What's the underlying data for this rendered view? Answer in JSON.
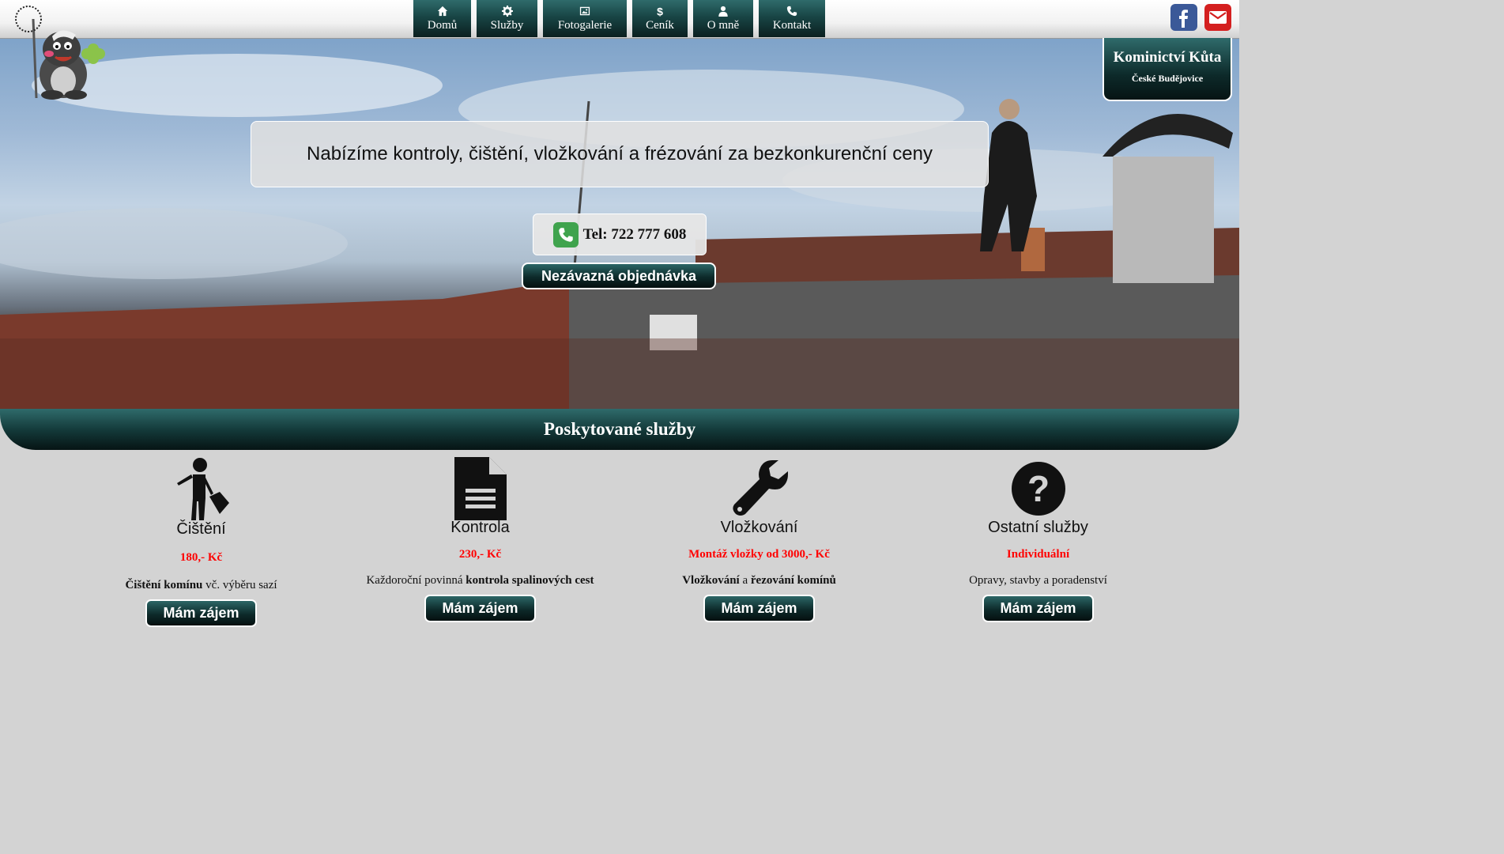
{
  "nav": [
    {
      "label": "Domů",
      "icon": "home-icon"
    },
    {
      "label": "Služby",
      "icon": "gear-icon"
    },
    {
      "label": "Fotogalerie",
      "icon": "image-icon"
    },
    {
      "label": "Ceník",
      "icon": "dollar-icon"
    },
    {
      "label": "O mně",
      "icon": "user-icon"
    },
    {
      "label": "Kontakt",
      "icon": "phone-icon"
    }
  ],
  "social": [
    {
      "icon": "facebook-icon",
      "color": "#3b5998"
    },
    {
      "icon": "mail-icon",
      "color": "#d41f1f"
    }
  ],
  "brand": {
    "title": "Kominictví Kůta",
    "subtitle": "České Budějovice"
  },
  "hero": {
    "headline": "Nabízíme kontroly, čištění, vložkování a frézování za bezkonkurenční ceny",
    "phone": "Tel: 722 777 608",
    "order_button": "Nezávazná objednávka"
  },
  "services_heading": "Poskytované služby",
  "services": [
    {
      "title": "Čištění",
      "price": "180,- Kč",
      "desc_bold": "Čištění komínu",
      "desc_rest": " vč. výběru sazí",
      "button": "Mám zájem",
      "icon": "chimney-sweep-icon"
    },
    {
      "title": "Kontrola",
      "price": "230,- Kč",
      "desc_pre": "Každoroční povinná ",
      "desc_bold": "kontrola spalinových cest",
      "button": "Mám zájem",
      "icon": "document-icon"
    },
    {
      "title": "Vložkování",
      "price": "Montáž vložky od 3000,- Kč",
      "desc_bold": "Vložkování",
      "desc_mid": " a ",
      "desc_bold2": "řezování komínů",
      "button": "Mám zájem",
      "icon": "wrench-icon"
    },
    {
      "title": "Ostatní služby",
      "price": "Individuální",
      "desc": "Opravy, stavby a poradenství",
      "button": "Mám zájem",
      "icon": "question-icon"
    }
  ],
  "colors": {
    "accent_dark": "#0d2a2a",
    "accent": "#2f6b6b",
    "price": "#ff0000",
    "background": "#d3d3d3"
  }
}
